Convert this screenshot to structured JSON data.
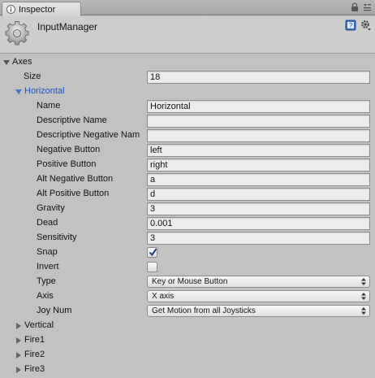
{
  "tab": {
    "label": "Inspector"
  },
  "header": {
    "title": "InputManager"
  },
  "axes": {
    "label": "Axes",
    "size_label": "Size",
    "size_value": "18"
  },
  "horizontal": {
    "label": "Horizontal",
    "fields": [
      {
        "label": "Name",
        "value": "Horizontal"
      },
      {
        "label": "Descriptive Name",
        "value": ""
      },
      {
        "label": "Descriptive Negative Nam",
        "value": ""
      },
      {
        "label": "Negative Button",
        "value": "left"
      },
      {
        "label": "Positive Button",
        "value": "right"
      },
      {
        "label": "Alt Negative Button",
        "value": "a"
      },
      {
        "label": "Alt Positive Button",
        "value": "d"
      },
      {
        "label": "Gravity",
        "value": "3"
      },
      {
        "label": "Dead",
        "value": "0.001"
      },
      {
        "label": "Sensitivity",
        "value": "3"
      }
    ],
    "snap": {
      "label": "Snap",
      "checked": true
    },
    "invert": {
      "label": "Invert",
      "checked": false
    },
    "type": {
      "label": "Type",
      "value": "Key or Mouse Button"
    },
    "axis": {
      "label": "Axis",
      "value": "X axis"
    },
    "joy_num": {
      "label": "Joy Num",
      "value": "Get Motion from all Joysticks"
    }
  },
  "collapsed_axes": [
    "Vertical",
    "Fire1",
    "Fire2",
    "Fire3"
  ]
}
